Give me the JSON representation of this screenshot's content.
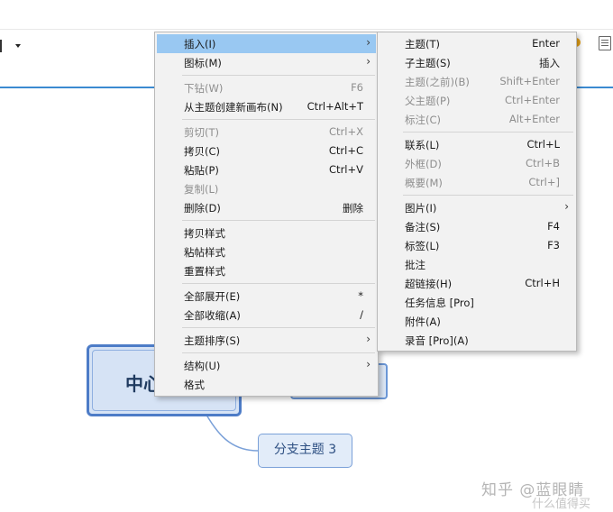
{
  "context_menu": {
    "items": [
      {
        "label": "插入(I)",
        "shortcut": "",
        "submenu": true
      },
      {
        "label": "图标(M)",
        "shortcut": "",
        "submenu": true
      },
      {
        "label": "下钻(W)",
        "shortcut": "F6",
        "disabled": true
      },
      {
        "label": "从主题创建新画布(N)",
        "shortcut": "Ctrl+Alt+T"
      },
      {
        "label": "剪切(T)",
        "shortcut": "Ctrl+X",
        "disabled": true
      },
      {
        "label": "拷贝(C)",
        "shortcut": "Ctrl+C"
      },
      {
        "label": "粘贴(P)",
        "shortcut": "Ctrl+V"
      },
      {
        "label": "复制(L)",
        "shortcut": "",
        "disabled": true
      },
      {
        "label": "删除(D)",
        "shortcut": "删除"
      },
      {
        "label": "拷贝样式",
        "shortcut": ""
      },
      {
        "label": "粘帖样式",
        "shortcut": ""
      },
      {
        "label": "重置样式",
        "shortcut": ""
      },
      {
        "label": "全部展开(E)",
        "shortcut": "*"
      },
      {
        "label": "全部收缩(A)",
        "shortcut": "/"
      },
      {
        "label": "主题排序(S)",
        "shortcut": "",
        "submenu": true
      },
      {
        "label": "结构(U)",
        "shortcut": "",
        "submenu": true
      },
      {
        "label": "格式",
        "shortcut": ""
      }
    ]
  },
  "insert_submenu": {
    "items": [
      {
        "label": "主题(T)",
        "shortcut": "Enter"
      },
      {
        "label": "子主题(S)",
        "shortcut": "插入"
      },
      {
        "label": "主题(之前)(B)",
        "shortcut": "Shift+Enter",
        "disabled": true
      },
      {
        "label": "父主题(P)",
        "shortcut": "Ctrl+Enter",
        "disabled": true
      },
      {
        "label": "标注(C)",
        "shortcut": "Alt+Enter",
        "disabled": true
      },
      {
        "label": "联系(L)",
        "shortcut": "Ctrl+L"
      },
      {
        "label": "外框(D)",
        "shortcut": "Ctrl+B",
        "disabled": true
      },
      {
        "label": "概要(M)",
        "shortcut": "Ctrl+]",
        "disabled": true
      },
      {
        "label": "图片(I)",
        "shortcut": "",
        "submenu": true
      },
      {
        "label": "备注(S)",
        "shortcut": "F4"
      },
      {
        "label": "标签(L)",
        "shortcut": "F3"
      },
      {
        "label": "批注",
        "shortcut": ""
      },
      {
        "label": "超链接(H)",
        "shortcut": "Ctrl+H"
      },
      {
        "label": "任务信息 [Pro]",
        "shortcut": ""
      },
      {
        "label": "附件(A)",
        "shortcut": ""
      },
      {
        "label": "录音 [Pro](A)",
        "shortcut": ""
      }
    ]
  },
  "mindmap": {
    "central_topic": "中心",
    "subtopic_3": "分支主题 3"
  },
  "watermark": {
    "line1": "知乎 @蓝眼睛",
    "line2": "什么值得买"
  },
  "colors": {
    "highlight": "#99c8f2",
    "accent_line": "#3b8ad1",
    "topic_border": "#4d7cc7"
  }
}
